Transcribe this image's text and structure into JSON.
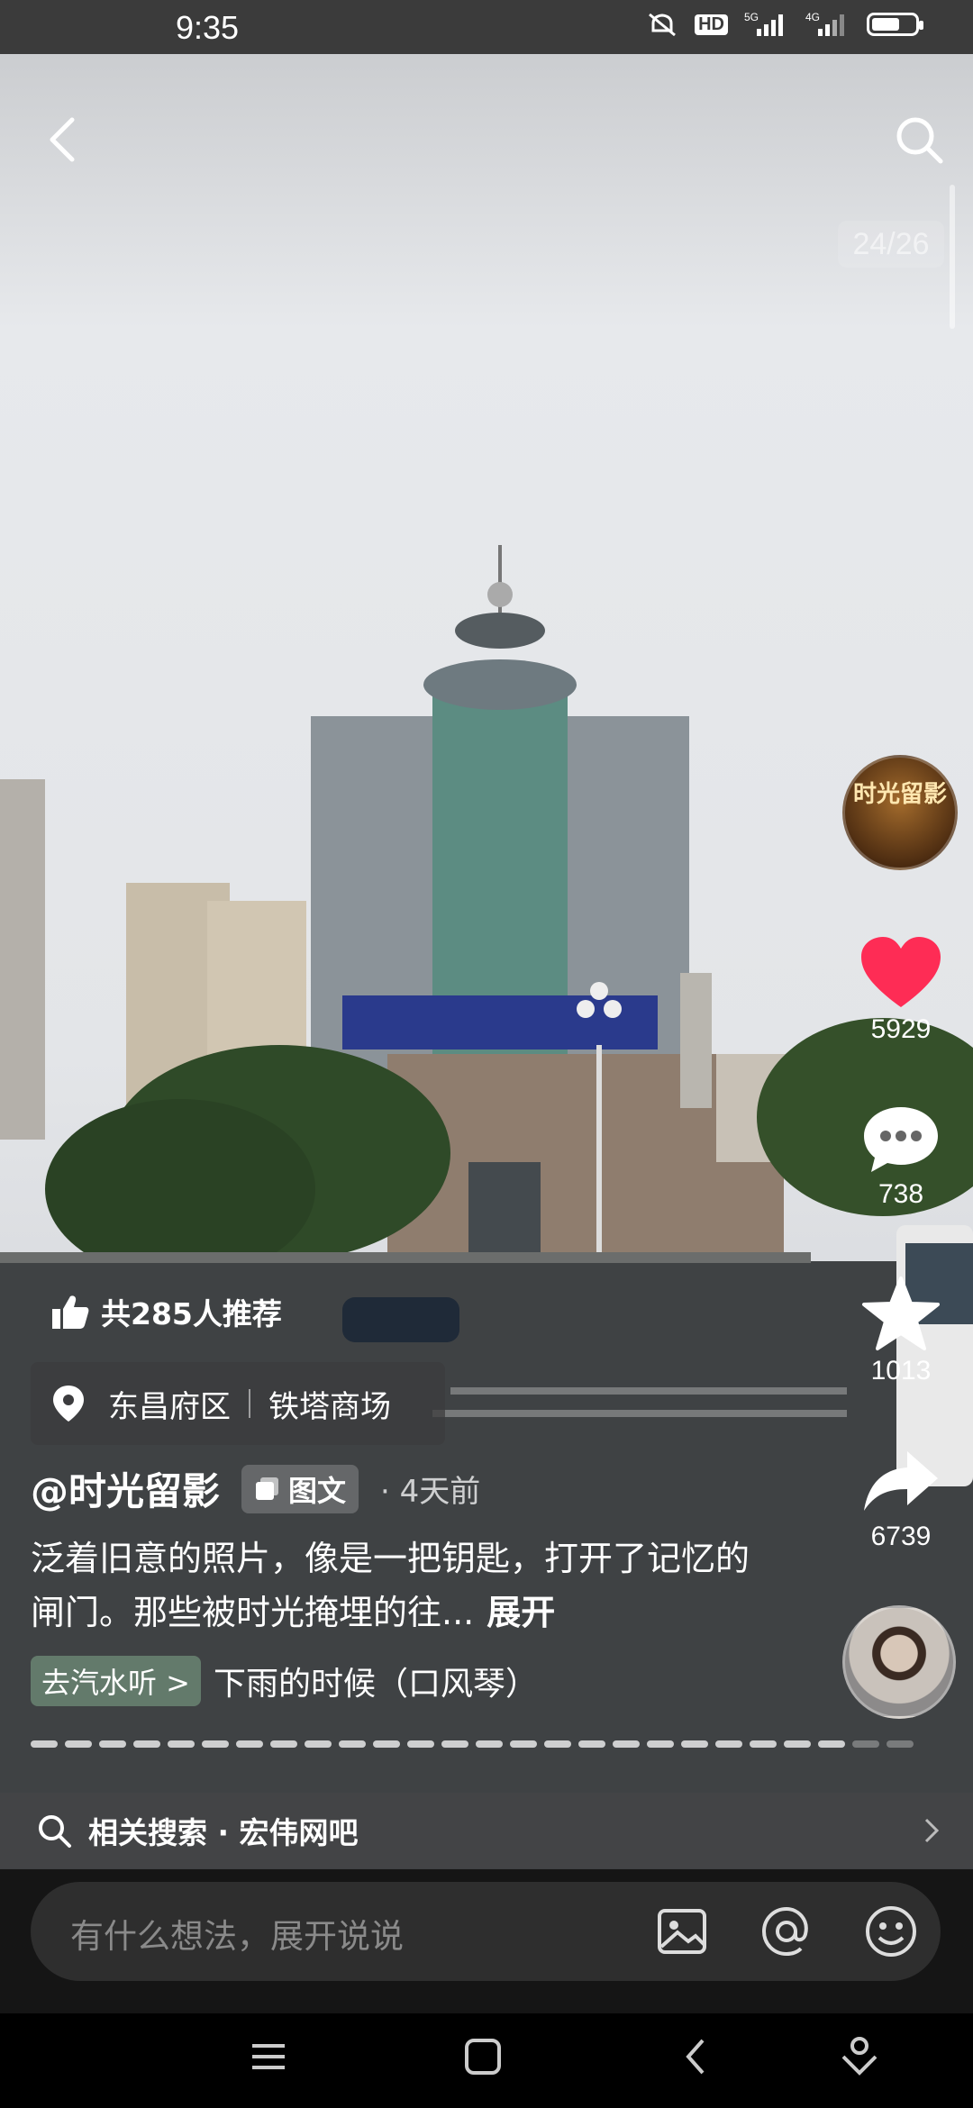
{
  "status": {
    "time": "9:35",
    "icons": [
      "mute-icon",
      "HD",
      "5G",
      "4G",
      "battery-icon"
    ]
  },
  "viewer": {
    "page_indicator": "24/26"
  },
  "actions": {
    "avatar_text": "时光留影",
    "likes": "5929",
    "comments": "738",
    "favorites": "1013",
    "shares": "6739"
  },
  "recommend": {
    "text": "共285人推荐"
  },
  "location": {
    "district": "东昌府区",
    "place": "铁塔商场"
  },
  "post": {
    "author": "@时光留影",
    "type_tag": "图文",
    "time_ago": "· 4天前",
    "description": "泛着旧意的照片，像是一把钥匙，打开了记忆的闸门。那些被时光掩埋的往...",
    "expand_label": "展开"
  },
  "music": {
    "tag": "去汽水听 >",
    "title": "下雨的时候（口风琴）"
  },
  "progress": {
    "total": 26,
    "current": 24
  },
  "related": {
    "label": "相关搜索 · 宏伟网吧"
  },
  "comment": {
    "placeholder": "有什么想法，展开说说"
  },
  "colors": {
    "like": "#fe2c55",
    "bg": "#151515",
    "input": "#2e2e2e"
  }
}
